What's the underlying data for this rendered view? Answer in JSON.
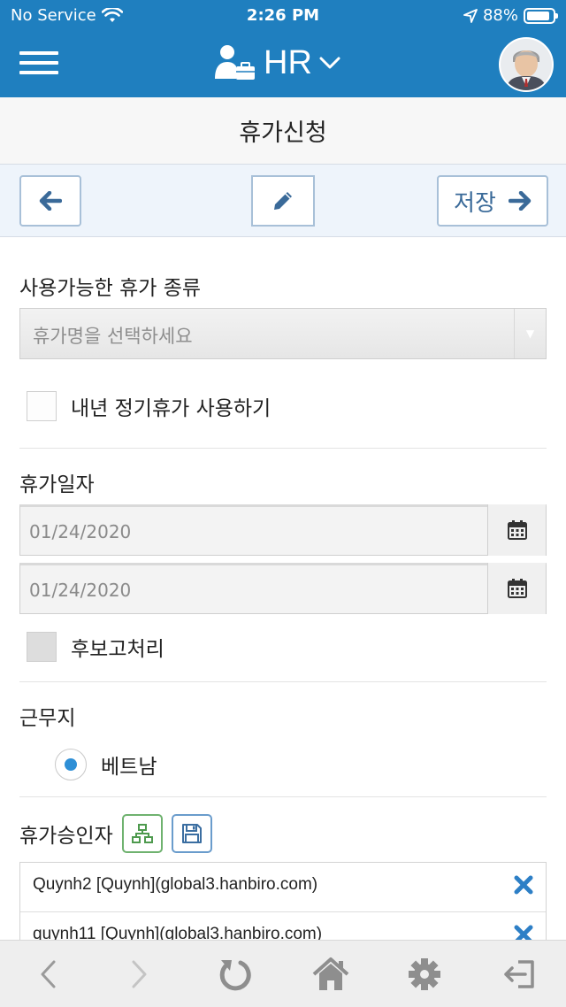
{
  "status": {
    "carrier": "No Service",
    "time": "2:26 PM",
    "battery": "88%",
    "battery_level": 0.88
  },
  "header": {
    "app_title": "HR",
    "menu_icon": "hamburger-icon",
    "app_icon": "briefcase-user-icon",
    "dropdown_icon": "chevron-down-icon"
  },
  "page": {
    "title": "휴가신청"
  },
  "toolbar": {
    "save_label": "저장"
  },
  "form": {
    "leave_type": {
      "label": "사용가능한 휴가 종류",
      "placeholder": "휴가명을 선택하세요"
    },
    "next_year_checkbox": {
      "label": "내년 정기휴가 사용하기",
      "checked": false
    },
    "leave_date": {
      "label": "휴가일자",
      "start": "01/24/2020",
      "end": "01/24/2020"
    },
    "post_report_checkbox": {
      "label": "후보고처리",
      "checked": false
    },
    "workplace": {
      "label": "근무지",
      "selected_option": "베트남"
    },
    "approvers": {
      "label": "휴가승인자",
      "items": [
        {
          "name": "Quynh2 [Quynh](global3.hanbiro.com)"
        },
        {
          "name": "quynh11 [Quynh](global3.hanbiro.com)"
        }
      ]
    }
  },
  "colors": {
    "header_bg": "#1f7fbf",
    "accent_blue": "#2e8fd6",
    "remove_icon": "#2d7fc6"
  }
}
